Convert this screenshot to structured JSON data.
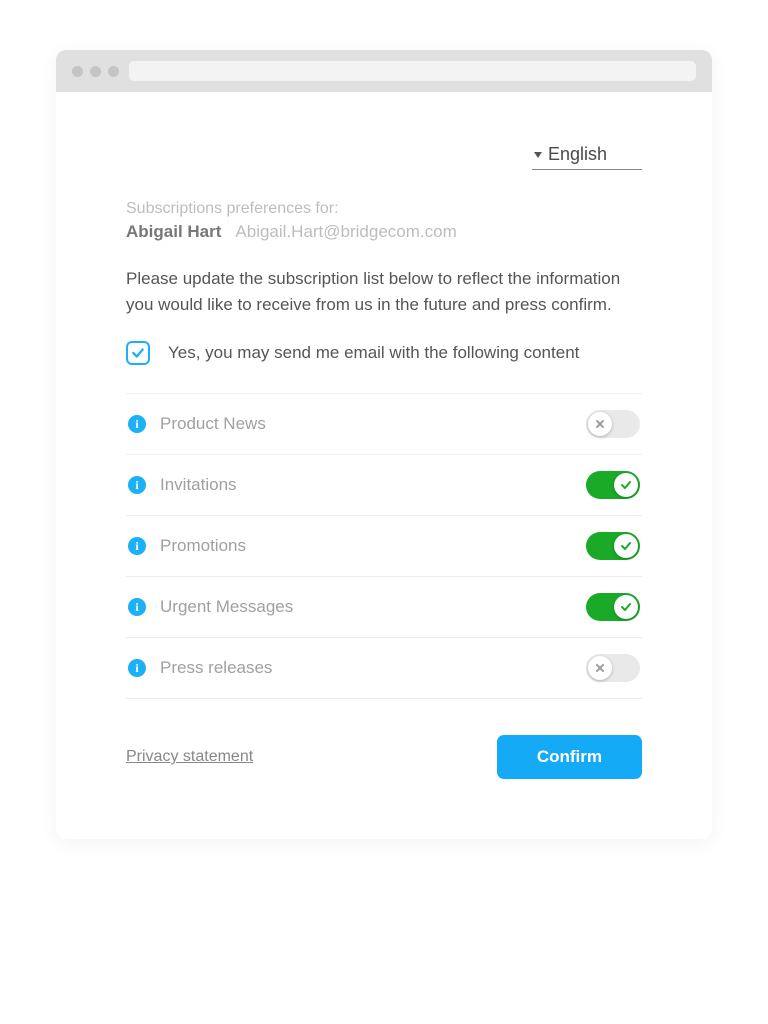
{
  "language": {
    "selected": "English"
  },
  "header": {
    "preferences_for": "Subscriptions preferences for:",
    "user_name": "Abigail Hart",
    "user_email": "Abigail.Hart@bridgecom.com"
  },
  "instructions": "Please update the subscription list below to reflect the information you would like to receive from us in the future and press confirm.",
  "consent": {
    "checked": true,
    "label": "Yes, you may send me email with the following content"
  },
  "subscriptions": [
    {
      "label": "Product News",
      "on": false
    },
    {
      "label": "Invitations",
      "on": true
    },
    {
      "label": "Promotions",
      "on": true
    },
    {
      "label": "Urgent Messages",
      "on": true
    },
    {
      "label": "Press releases",
      "on": false
    }
  ],
  "footer": {
    "privacy_label": "Privacy statement",
    "confirm_label": "Confirm"
  },
  "colors": {
    "accent_blue": "#14aaf5",
    "toggle_green": "#1aaa28",
    "info_blue": "#1cb0f6"
  }
}
